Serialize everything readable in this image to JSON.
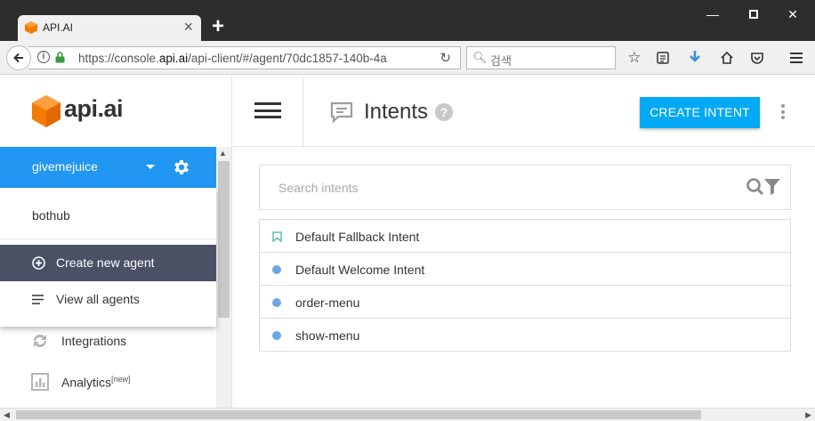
{
  "browser": {
    "tab_title": "API.AI",
    "tab_close": "×",
    "new_tab": "+",
    "url_host": "https://console.",
    "url_domain": "api.ai",
    "url_path": "/api-client/#/agent/70dc1857-140b-4a",
    "search_placeholder": "검색",
    "window_controls": {
      "minimize": "—",
      "close": "✕"
    }
  },
  "logo": {
    "text": "api.ai",
    "color": "#f57c00"
  },
  "agent": {
    "current": "givemejuice",
    "other_agents": [
      "bothub"
    ],
    "create_label": "Create new agent",
    "view_all_label": "View all agents"
  },
  "sidebar": {
    "items": [
      {
        "label": "Integrations",
        "badge": ""
      },
      {
        "label": "Analytics",
        "badge": "[new]"
      }
    ]
  },
  "header": {
    "title": "Intents",
    "create_button": "CREATE INTENT"
  },
  "search": {
    "placeholder": "Search intents"
  },
  "intents": [
    {
      "label": "Default Fallback Intent",
      "marker": "bookmark"
    },
    {
      "label": "Default Welcome Intent",
      "marker": "dot"
    },
    {
      "label": "order-menu",
      "marker": "dot"
    },
    {
      "label": "show-menu",
      "marker": "dot"
    }
  ],
  "colors": {
    "primary": "#2196f3",
    "button": "#03a9f4",
    "dropdown_active": "#4a5165",
    "intent_dot": "#6aa8e3",
    "fallback_icon": "#5bbfb0"
  }
}
